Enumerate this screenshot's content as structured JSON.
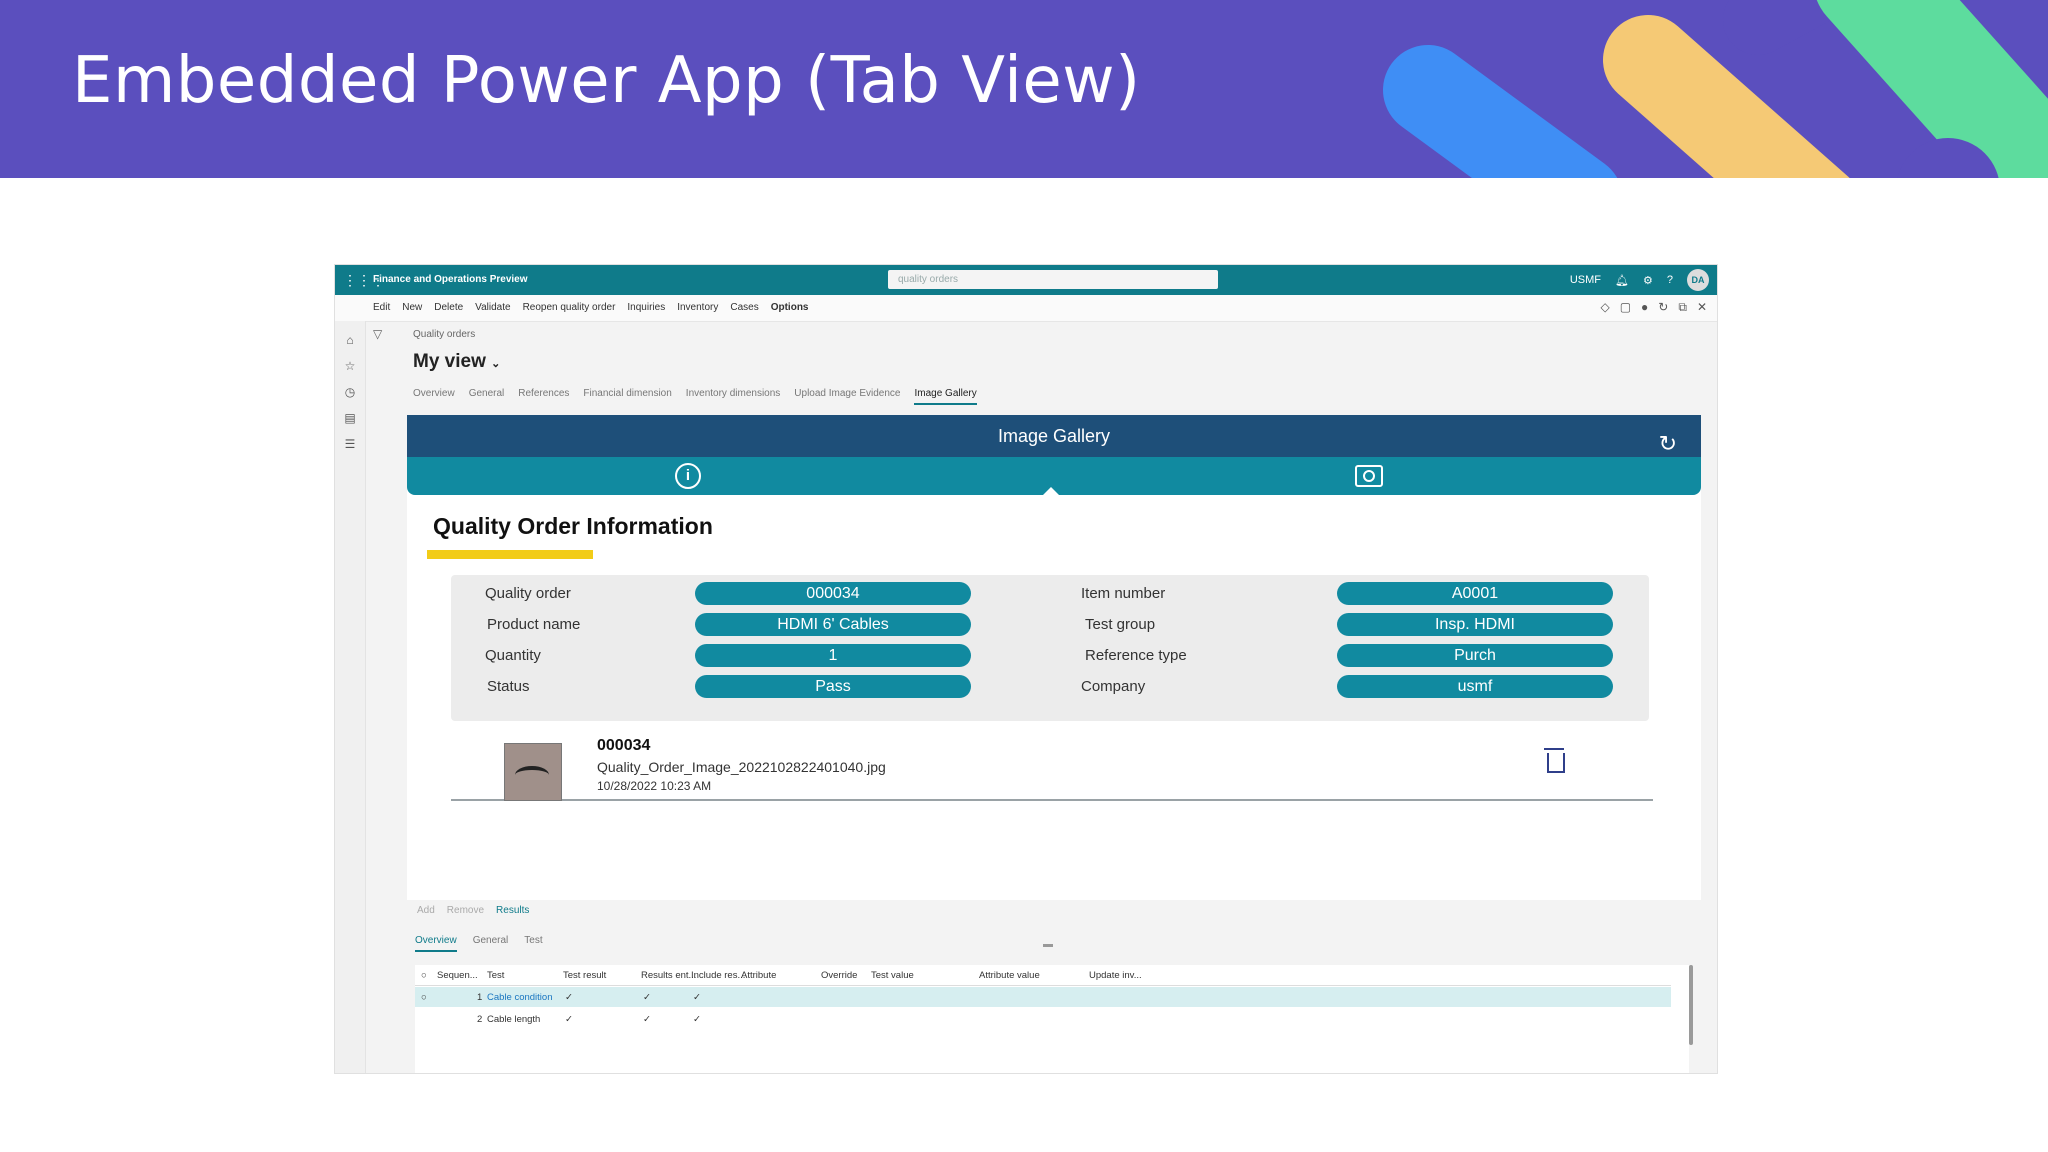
{
  "slide": {
    "title": "Embedded Power App (Tab View)",
    "banner_color": "#5b4fbe"
  },
  "app": {
    "title": "Finance and Operations Preview",
    "search_placeholder": "quality orders",
    "company": "USMF",
    "avatar_initials": "DA"
  },
  "actions": [
    "Edit",
    "New",
    "Delete",
    "Validate",
    "Reopen quality order",
    "Inquiries",
    "Inventory",
    "Cases",
    "Options"
  ],
  "page": {
    "breadcrumb": "Quality orders",
    "view_name": "My view",
    "tabs": [
      "Overview",
      "General",
      "References",
      "Financial dimension",
      "Inventory dimensions",
      "Upload Image Evidence",
      "Image Gallery"
    ],
    "active_tab": "Image Gallery"
  },
  "gallery": {
    "header": "Image Gallery",
    "section_title": "Quality Order Information",
    "fields": [
      {
        "label": "Quality order",
        "value": "000034"
      },
      {
        "label": "Product name",
        "value": "HDMI 6' Cables"
      },
      {
        "label": "Quantity",
        "value": "1"
      },
      {
        "label": "Status",
        "value": "Pass"
      },
      {
        "label": "Item number",
        "value": "A0001"
      },
      {
        "label": "Test group",
        "value": "Insp. HDMI"
      },
      {
        "label": "Reference type",
        "value": "Purch"
      },
      {
        "label": "Company",
        "value": "usmf"
      }
    ],
    "image": {
      "title": "000034",
      "filename": "Quality_Order_Image_2022102822401040.jpg",
      "date": "10/28/2022 10:23 AM"
    }
  },
  "lower": {
    "actions": [
      "Add",
      "Remove",
      "Results"
    ],
    "subtabs": [
      "Overview",
      "General",
      "Test"
    ],
    "columns": [
      "Sequen...",
      "Test",
      "Test result",
      "Results ent...",
      "Include res...",
      "Attribute",
      "Override",
      "Test value",
      "Attribute value",
      "Update inv..."
    ],
    "rows": [
      {
        "seq": "1",
        "test": "Cable condition"
      },
      {
        "seq": "2",
        "test": "Cable length"
      }
    ]
  }
}
